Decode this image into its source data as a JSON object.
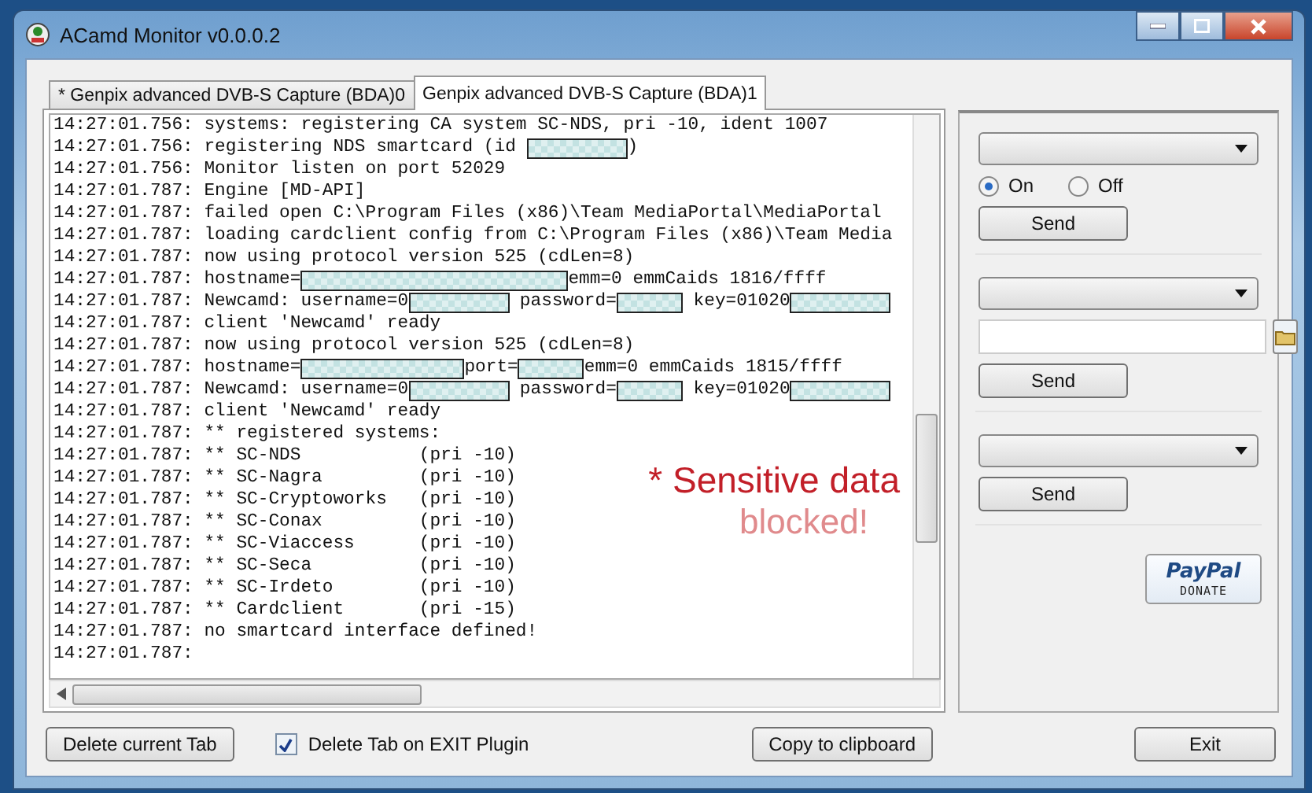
{
  "window": {
    "title": "ACamd Monitor v0.0.0.2"
  },
  "tabs": [
    {
      "label": "* Genpix advanced DVB-S Capture (BDA)0",
      "selected": false
    },
    {
      "label": "Genpix advanced DVB-S Capture (BDA)1",
      "selected": true
    }
  ],
  "log": [
    {
      "parts": [
        {
          "kind": "text",
          "text": "14:27:01.756: systems: registering CA system SC-NDS, pri -10, ident 1007"
        }
      ]
    },
    {
      "parts": [
        {
          "kind": "text",
          "text": "14:27:01.756: registering NDS smartcard (id "
        },
        {
          "kind": "redacted-medium"
        },
        {
          "kind": "text",
          "text": ")"
        }
      ]
    },
    {
      "parts": [
        {
          "kind": "text",
          "text": "14:27:01.756: Monitor listen on port 52029"
        }
      ]
    },
    {
      "parts": [
        {
          "kind": "text",
          "text": "14:27:01.787: Engine [MD-API]"
        }
      ]
    },
    {
      "parts": [
        {
          "kind": "text",
          "text": "14:27:01.787: failed open C:\\Program Files (x86)\\Team MediaPortal\\MediaPortal"
        }
      ]
    },
    {
      "parts": [
        {
          "kind": "text",
          "text": "14:27:01.787: loading cardclient config from C:\\Program Files (x86)\\Team Media"
        }
      ]
    },
    {
      "parts": [
        {
          "kind": "text",
          "text": "14:27:01.787: now using protocol version 525 (cdLen=8)"
        }
      ]
    },
    {
      "parts": [
        {
          "kind": "text",
          "text": "14:27:01.787: hostname="
        },
        {
          "kind": "redacted-long"
        },
        {
          "kind": "text",
          "text": "emm=0 emmCaids 1816/ffff"
        }
      ]
    },
    {
      "parts": [
        {
          "kind": "text",
          "text": "14:27:01.787: Newcamd: username=0"
        },
        {
          "kind": "redacted-medium"
        },
        {
          "kind": "text",
          "text": " password="
        },
        {
          "kind": "redacted-short"
        },
        {
          "kind": "text",
          "text": " key=01020"
        },
        {
          "kind": "redacted-medium"
        }
      ]
    },
    {
      "parts": [
        {
          "kind": "text",
          "text": "14:27:01.787: client 'Newcamd' ready"
        }
      ]
    },
    {
      "parts": [
        {
          "kind": "text",
          "text": "14:27:01.787: now using protocol version 525 (cdLen=8)"
        }
      ]
    },
    {
      "parts": [
        {
          "kind": "text",
          "text": "14:27:01.787: hostname="
        },
        {
          "kind": "redacted-wide"
        },
        {
          "kind": "text",
          "text": "port="
        },
        {
          "kind": "redacted-short"
        },
        {
          "kind": "text",
          "text": "emm=0 emmCaids 1815/ffff"
        }
      ]
    },
    {
      "parts": [
        {
          "kind": "text",
          "text": "14:27:01.787: Newcamd: username=0"
        },
        {
          "kind": "redacted-medium"
        },
        {
          "kind": "text",
          "text": " password="
        },
        {
          "kind": "redacted-short"
        },
        {
          "kind": "text",
          "text": " key=01020"
        },
        {
          "kind": "redacted-medium"
        }
      ]
    },
    {
      "parts": [
        {
          "kind": "text",
          "text": "14:27:01.787: client 'Newcamd' ready"
        }
      ]
    },
    {
      "parts": [
        {
          "kind": "text",
          "text": "14:27:01.787: ** registered systems:"
        }
      ]
    },
    {
      "parts": [
        {
          "kind": "text",
          "text": "14:27:01.787: ** SC-NDS           (pri -10)"
        }
      ]
    },
    {
      "parts": [
        {
          "kind": "text",
          "text": "14:27:01.787: ** SC-Nagra         (pri -10)"
        }
      ]
    },
    {
      "parts": [
        {
          "kind": "text",
          "text": "14:27:01.787: ** SC-Cryptoworks   (pri -10)"
        }
      ]
    },
    {
      "parts": [
        {
          "kind": "text",
          "text": "14:27:01.787: ** SC-Conax         (pri -10)"
        }
      ]
    },
    {
      "parts": [
        {
          "kind": "text",
          "text": "14:27:01.787: ** SC-Viaccess      (pri -10)"
        }
      ]
    },
    {
      "parts": [
        {
          "kind": "text",
          "text": "14:27:01.787: ** SC-Seca          (pri -10)"
        }
      ]
    },
    {
      "parts": [
        {
          "kind": "text",
          "text": "14:27:01.787: ** SC-Irdeto        (pri -10)"
        }
      ]
    },
    {
      "parts": [
        {
          "kind": "text",
          "text": "14:27:01.787: ** Cardclient       (pri -15)"
        }
      ]
    },
    {
      "parts": [
        {
          "kind": "text",
          "text": "14:27:01.787: no smartcard interface defined!"
        }
      ]
    },
    {
      "parts": [
        {
          "kind": "text",
          "text": "14:27:01.787:"
        }
      ]
    }
  ],
  "annotation": {
    "line_1": "* Sensitive data",
    "line_2": "blocked!"
  },
  "side_panel": {
    "group_1": {
      "radios": [
        {
          "label": "On",
          "selected": true
        },
        {
          "label": "Off",
          "selected": false
        }
      ],
      "button": "Send"
    },
    "group_2": {
      "button": "Send"
    },
    "group_3": {
      "button": "Send"
    },
    "donate": {
      "brand": "PayPal",
      "label": "DONATE"
    }
  },
  "footer": {
    "delete_button": "Delete current Tab",
    "checkbox": {
      "label": "Delete Tab on EXIT Plugin",
      "checked": true
    },
    "copy_button": "Copy to clipboard",
    "exit_button": "Exit"
  }
}
